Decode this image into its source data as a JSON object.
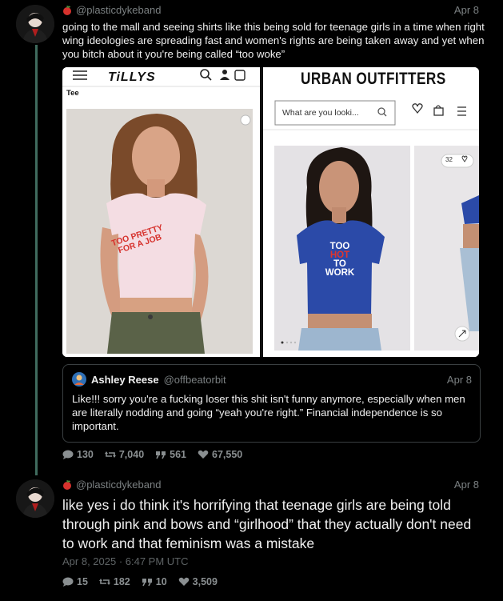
{
  "post1": {
    "handle": "@plasticdykeband",
    "date": "Apr 8",
    "text": "going to the mall and seeing shirts like this being sold for teenage girls in a time when right wing ideologies are spreading fast and women's rights are being taken away and yet when you bitch about it you're being called “too woke”",
    "image": {
      "left": {
        "brand": "TiLLYS",
        "label": "Tee",
        "shirt_text_line1": "TOO PRETTY",
        "shirt_text_line2": "FOR A JOB"
      },
      "right": {
        "brand": "URBAN OUTFITTERS",
        "search_placeholder": "What are you looki...",
        "shirt_text": [
          "TOO",
          "HOT",
          "TO",
          "WORK"
        ],
        "like_count": "32"
      }
    },
    "quote": {
      "name": "Ashley Reese",
      "handle": "@offbeatorbit",
      "date": "Apr 8",
      "text": "Like!!! sorry you're a fucking loser this shit isn't funny anymore, especially when men are literally nodding and going “yeah you're right.” Financial independence is so important."
    },
    "stats": {
      "replies": "130",
      "reblogs": "7,040",
      "quotes": "561",
      "likes": "67,550"
    }
  },
  "post2": {
    "handle": "@plasticdykeband",
    "date": "Apr 8",
    "text": "like yes i do think it's horrifying that teenage girls are being told through pink and bows and “girlhood” that they actually don't need to work and that feminism was a mistake",
    "timestamp": "Apr 8, 2025 · 6:47 PM UTC",
    "stats": {
      "replies": "15",
      "reblogs": "182",
      "quotes": "10",
      "likes": "3,509"
    }
  },
  "colors": {
    "background": "#000000",
    "thread": "#3f6b5e",
    "muted": "#7b8082",
    "accent_red": "#d6322d"
  }
}
